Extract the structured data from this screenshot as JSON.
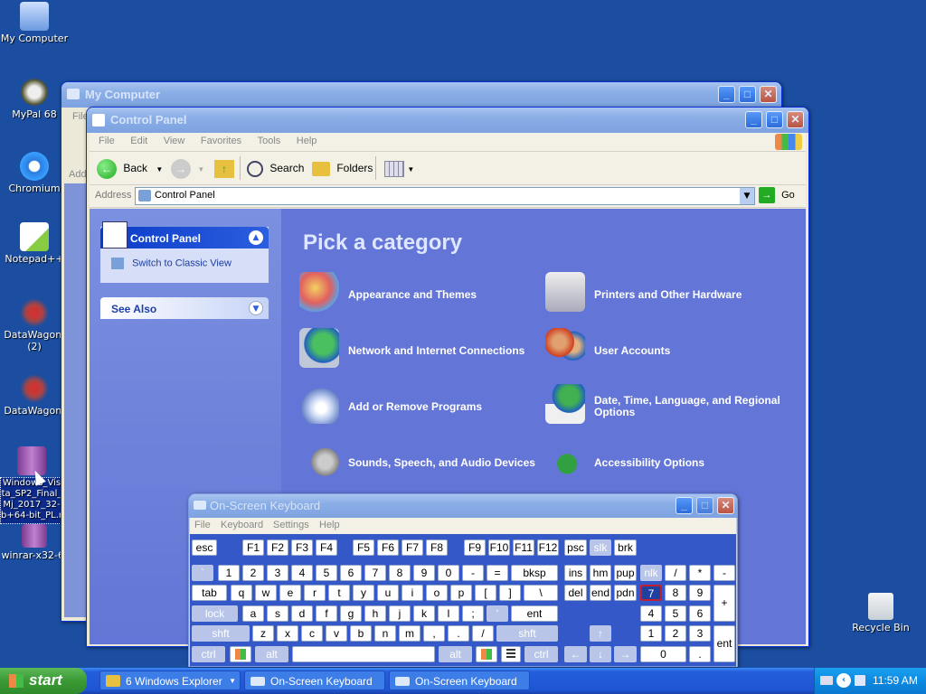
{
  "desktop": {
    "icons": [
      {
        "label": "My Computer"
      },
      {
        "label": "MyPal 68"
      },
      {
        "label": "Chromium"
      },
      {
        "label": "Notepad++"
      },
      {
        "label": "DataWagon.\n(2)"
      },
      {
        "label": "DataWagon."
      },
      {
        "label": "Windows_Vista_SP2_Final_Mj_2017_32-b+64-bit_PL.rar"
      },
      {
        "label": "winrar-x32-6."
      },
      {
        "label": "Recycle Bin"
      }
    ]
  },
  "my_computer_window": {
    "title": "My Computer",
    "menu_file": "File",
    "address_label": "Addr"
  },
  "control_panel_window": {
    "title": "Control Panel",
    "menu": [
      "File",
      "Edit",
      "View",
      "Favorites",
      "Tools",
      "Help"
    ],
    "toolbar": {
      "back": "Back",
      "search": "Search",
      "folders": "Folders"
    },
    "address": {
      "label": "Address",
      "value": "Control Panel",
      "go": "Go"
    },
    "sidebar": {
      "panel_title": "Control Panel",
      "switch_view": "Switch to Classic View",
      "see_also": "See Also"
    },
    "heading": "Pick a category",
    "categories": [
      {
        "label": "Appearance and Themes"
      },
      {
        "label": "Printers and Other Hardware"
      },
      {
        "label": "Network and Internet Connections"
      },
      {
        "label": "User Accounts"
      },
      {
        "label": "Add or Remove Programs"
      },
      {
        "label": "Date, Time, Language, and Regional Options"
      },
      {
        "label": "Sounds, Speech, and Audio Devices"
      },
      {
        "label": "Accessibility Options"
      }
    ]
  },
  "osk_window": {
    "title": "On-Screen Keyboard",
    "menu": [
      "File",
      "Keyboard",
      "Settings",
      "Help"
    ],
    "keys": {
      "row_fn": [
        "esc",
        "F1",
        "F2",
        "F3",
        "F4",
        "F5",
        "F6",
        "F7",
        "F8",
        "F9",
        "F10",
        "F11",
        "F12",
        "psc",
        "slk",
        "brk"
      ],
      "row_num": [
        "`",
        "1",
        "2",
        "3",
        "4",
        "5",
        "6",
        "7",
        "8",
        "9",
        "0",
        "-",
        "=",
        "bksp",
        "ins",
        "hm",
        "pup",
        "nlk",
        "/",
        "*",
        "-"
      ],
      "row_tab": [
        "tab",
        "q",
        "w",
        "e",
        "r",
        "t",
        "y",
        "u",
        "i",
        "o",
        "p",
        "[",
        "]",
        "\\",
        "del",
        "end",
        "pdn",
        "7",
        "8",
        "9",
        "+"
      ],
      "row_caps": [
        "lock",
        "a",
        "s",
        "d",
        "f",
        "g",
        "h",
        "j",
        "k",
        "l",
        ";",
        "'",
        "ent",
        "4",
        "5",
        "6"
      ],
      "row_shift": [
        "shft",
        "z",
        "x",
        "c",
        "v",
        "b",
        "n",
        "m",
        ",",
        ".",
        "/",
        "shft",
        "1",
        "2",
        "3",
        "ent"
      ],
      "row_ctrl": [
        "ctrl",
        "alt",
        "alt",
        "ctrl",
        "0",
        "."
      ]
    }
  },
  "taskbar": {
    "start": "start",
    "items": [
      "6 Windows Explorer",
      "On-Screen Keyboard",
      "On-Screen Keyboard"
    ],
    "clock": "11:59 AM"
  }
}
